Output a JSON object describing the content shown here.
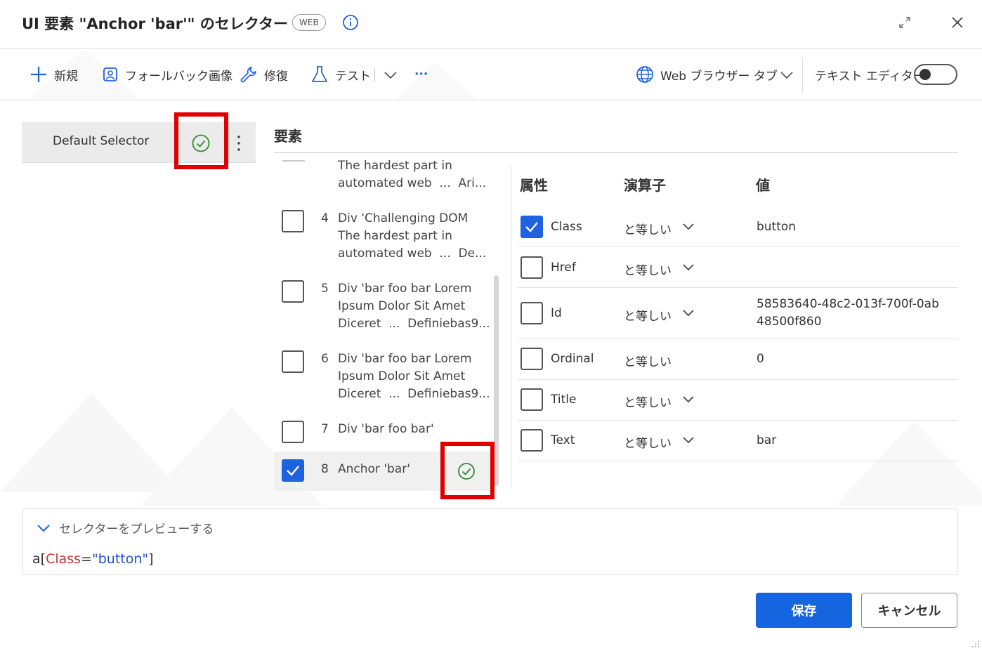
{
  "window": {
    "title": "UI 要素 \"Anchor 'bar'\" のセレクター",
    "badge": "WEB"
  },
  "toolbar": {
    "new_label": "新規",
    "fallback_label": "フォールバック画像",
    "repair_label": "修復",
    "test_label": "テスト",
    "more_label": "···",
    "browser_tab_label": "Web ブラウザー タブ",
    "text_editor_label": "テキスト エディター",
    "text_editor_on": false
  },
  "selectors": [
    {
      "name": "Default Selector",
      "status": "valid"
    }
  ],
  "elements_section": {
    "title": "要素",
    "items": [
      {
        "num": "",
        "lines": [
          "The hardest part in",
          "automated web  ...  Ari..."
        ],
        "checked": false
      },
      {
        "num": "4",
        "lines": [
          "Div 'Challenging DOM",
          "The hardest part in",
          "automated web  ...  De..."
        ],
        "checked": false
      },
      {
        "num": "5",
        "lines": [
          "Div 'bar foo bar Lorem",
          "Ipsum Dolor Sit Amet",
          "Diceret  ...  Definiebas9..."
        ],
        "checked": false
      },
      {
        "num": "6",
        "lines": [
          "Div 'bar foo bar Lorem",
          "Ipsum Dolor Sit Amet",
          "Diceret  ...  Definiebas9..."
        ],
        "checked": false
      },
      {
        "num": "7",
        "lines": [
          "Div 'bar foo bar'"
        ],
        "checked": false
      },
      {
        "num": "8",
        "lines": [
          "Anchor 'bar'"
        ],
        "checked": true,
        "selected": true,
        "status": "valid"
      }
    ]
  },
  "attributes": {
    "headers": {
      "attr": "属性",
      "operator": "演算子",
      "value": "値"
    },
    "rows": [
      {
        "name": "Class",
        "operator": "と等しい",
        "value": "button",
        "checked": true,
        "has_dropdown": true
      },
      {
        "name": "Href",
        "operator": "と等しい",
        "value": "",
        "checked": false,
        "has_dropdown": true
      },
      {
        "name": "Id",
        "operator": "と等しい",
        "value": "58583640-48c2-013f-700f-0ab\n48500f860",
        "checked": false,
        "has_dropdown": true
      },
      {
        "name": "Ordinal",
        "operator": "と等しい",
        "value": "0",
        "checked": false,
        "has_dropdown": false
      },
      {
        "name": "Title",
        "operator": "と等しい",
        "value": "",
        "checked": false,
        "has_dropdown": true
      },
      {
        "name": "Text",
        "operator": "と等しい",
        "value": "bar",
        "checked": false,
        "has_dropdown": true
      }
    ]
  },
  "preview": {
    "label": "セレクターをプレビューする",
    "tag": "a",
    "open_bracket": "[",
    "attr": "Class",
    "eq": "=",
    "value": "\"button\"",
    "close_bracket": "]"
  },
  "footer": {
    "save_label": "保存",
    "cancel_label": "キャンセル"
  },
  "colors": {
    "accent": "#1565e0",
    "valid": "#2e8b2e",
    "highlight": "#e00000"
  }
}
